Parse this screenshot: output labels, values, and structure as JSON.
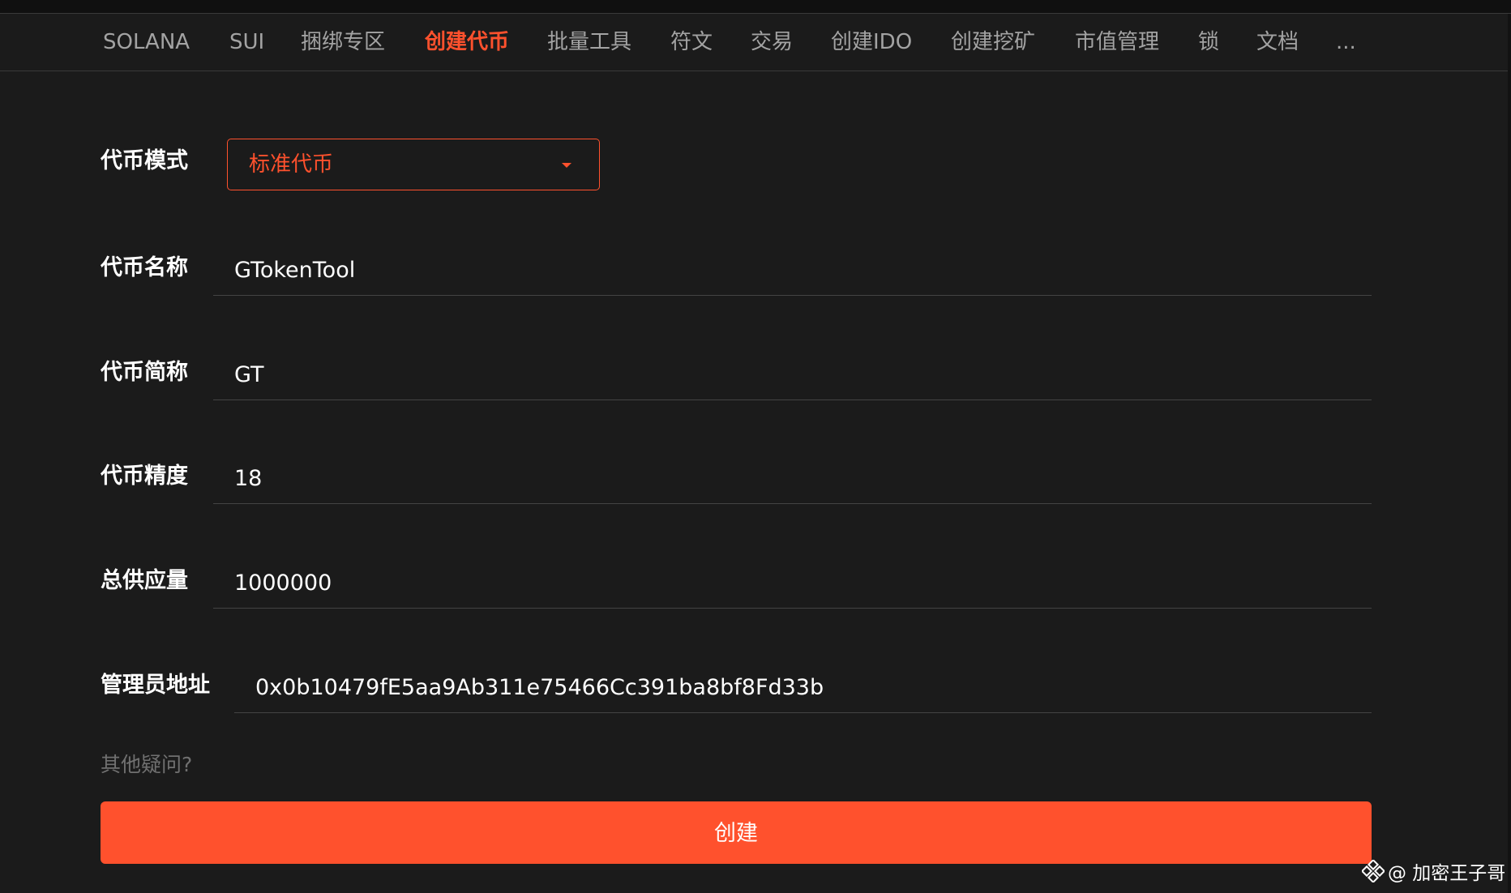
{
  "nav": {
    "items": [
      {
        "label": "SOLANA"
      },
      {
        "label": "SUI"
      },
      {
        "label": "捆绑专区"
      },
      {
        "label": "创建代币",
        "active": true
      },
      {
        "label": "批量工具"
      },
      {
        "label": "符文"
      },
      {
        "label": "交易"
      },
      {
        "label": "创建IDO"
      },
      {
        "label": "创建挖矿"
      },
      {
        "label": "市值管理"
      },
      {
        "label": "锁"
      },
      {
        "label": "文档"
      },
      {
        "label": "..."
      }
    ]
  },
  "form": {
    "mode": {
      "label": "代币模式",
      "value": "标准代币"
    },
    "name": {
      "label": "代币名称",
      "value": "GTokenTool"
    },
    "symbol": {
      "label": "代币简称",
      "value": "GT"
    },
    "decimals": {
      "label": "代币精度",
      "value": "18"
    },
    "supply": {
      "label": "总供应量",
      "value": "1000000"
    },
    "admin": {
      "label": "管理员地址",
      "value": "0x0b10479fE5aa9Ab311e75466Cc391ba8bf8Fd33b"
    }
  },
  "help_link": "其他疑问?",
  "create_button": "创建",
  "watermark": {
    "text": "@ 加密王子哥",
    "icon": "binance-diamond-icon"
  },
  "colors": {
    "accent": "#ff512d",
    "background": "#1b1b1b"
  }
}
